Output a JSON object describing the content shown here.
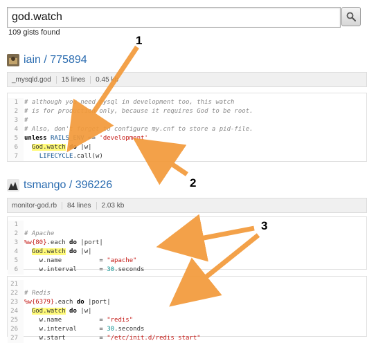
{
  "search": {
    "query": "god.watch"
  },
  "results": {
    "count_text": "109 gists found"
  },
  "gists": [
    {
      "title": "iain / 775894",
      "file": {
        "name": "_mysqld.god",
        "lines": "15 lines",
        "size": "0.45 kb"
      },
      "lines": [
        {
          "n": "1",
          "html": "<span class=\"cm\"># although you need mysql in development too, this watch</span>"
        },
        {
          "n": "2",
          "html": "<span class=\"cm\"># is for production only, because it requires God to be root.</span>"
        },
        {
          "n": "3",
          "html": "<span class=\"cm\">#</span>"
        },
        {
          "n": "4",
          "html": "<span class=\"cm\"># Also, don't forget to configure my.cnf to store a pid-file.</span>"
        },
        {
          "n": "5",
          "html": "<span class=\"kw\">unless</span> <span class=\"const\">RAILS_ENV</span> == <span class=\"str\">'development'</span>"
        },
        {
          "n": "6",
          "html": "  <span class=\"hl\">God.watch</span> <span class=\"kw\">do</span> |w|"
        },
        {
          "n": "7",
          "html": "    <span class=\"const\">LIFECYCLE</span>.call(w)"
        }
      ]
    },
    {
      "title": "tsmango / 396226",
      "file": {
        "name": "monitor-god.rb",
        "lines": "84 lines",
        "size": "2.03 kb"
      },
      "blocks": [
        [
          {
            "n": "1",
            "html": ""
          },
          {
            "n": "2",
            "html": "<span class=\"cm\"># Apache</span>"
          },
          {
            "n": "3",
            "html": "<span class=\"str\">%w{80}</span>.each <span class=\"kw\">do</span> |port|"
          },
          {
            "n": "4",
            "html": "  <span class=\"hl\">God.watch</span> <span class=\"kw\">do</span> |w|"
          },
          {
            "n": "5",
            "html": "    w.name          = <span class=\"str\">\"apache\"</span>"
          },
          {
            "n": "6",
            "html": "    w.interval      = <span class=\"num\">30</span>.seconds"
          }
        ],
        [
          {
            "n": "21",
            "html": ""
          },
          {
            "n": "22",
            "html": "<span class=\"cm\"># Redis</span>"
          },
          {
            "n": "23",
            "html": "<span class=\"str\">%w{6379}</span>.each <span class=\"kw\">do</span> |port|"
          },
          {
            "n": "24",
            "html": "  <span class=\"hl\">God.watch</span> <span class=\"kw\">do</span> |w|"
          },
          {
            "n": "25",
            "html": "    w.name          = <span class=\"str\">\"redis\"</span>"
          },
          {
            "n": "26",
            "html": "    w.interval      = <span class=\"num\">30</span>.seconds"
          },
          {
            "n": "27",
            "html": "    w.start         = <span class=\"str\">\"/etc/init.d/redis start\"</span>"
          }
        ]
      ]
    }
  ],
  "annotations": {
    "labels": [
      "1",
      "2",
      "3"
    ],
    "color": "#f39a3a"
  }
}
